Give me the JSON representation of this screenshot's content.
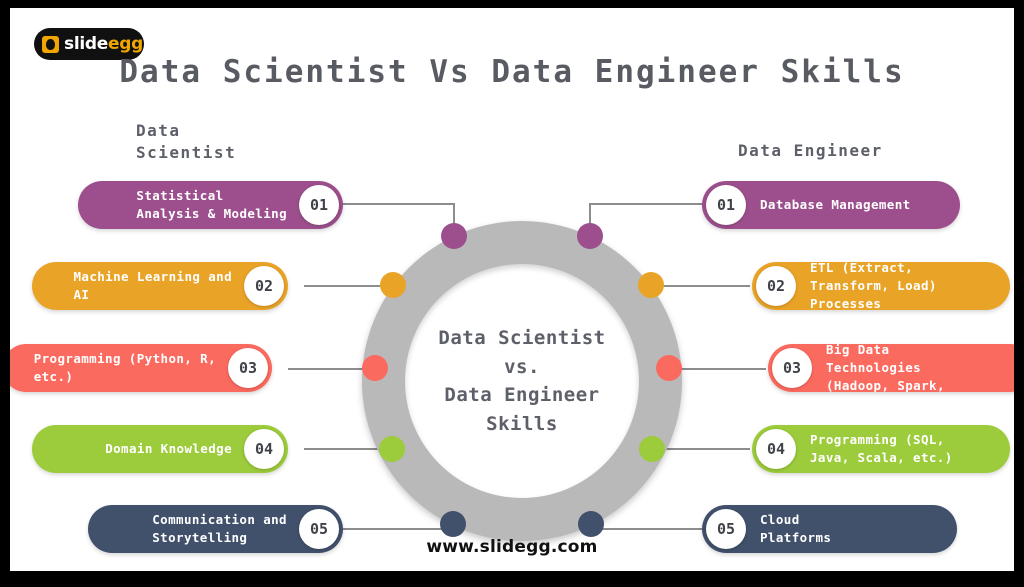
{
  "brand": {
    "logo_text_part1": "slide",
    "logo_text_part2": "egg",
    "logo_icon": "egg-icon"
  },
  "title": "Data Scientist Vs Data Engineer Skills",
  "columns": {
    "left_heading": "Data\nScientist",
    "right_heading": "Data Engineer"
  },
  "center": {
    "text": "Data Scientist\nvs.\nData Engineer\nSkills"
  },
  "colors": {
    "purple": "#9c4f8c",
    "orange": "#e9a327",
    "coral": "#fb6a5f",
    "green": "#9ccb3b",
    "slate": "#41506b",
    "ring": "#b9b9b9",
    "connector": "#8d8d8d",
    "text_gray": "#5d6068"
  },
  "left_items": [
    {
      "number": "01",
      "label": "Statistical\nAnalysis & Modeling",
      "color": "#9c4f8c"
    },
    {
      "number": "02",
      "label": "Machine Learning and\nAI",
      "color": "#e9a327"
    },
    {
      "number": "03",
      "label": "Programming (Python, R,\netc.)",
      "color": "#fb6a5f"
    },
    {
      "number": "04",
      "label": "Domain Knowledge",
      "color": "#9ccb3b"
    },
    {
      "number": "05",
      "label": "Communication and\nStorytelling",
      "color": "#41506b"
    }
  ],
  "right_items": [
    {
      "number": "01",
      "label": "Database Management",
      "color": "#9c4f8c"
    },
    {
      "number": "02",
      "label": "ETL (Extract,\nTransform, Load)\nProcesses",
      "color": "#e9a327"
    },
    {
      "number": "03",
      "label": "Big Data\nTechnologies\n(Hadoop, Spark,",
      "color": "#fb6a5f"
    },
    {
      "number": "04",
      "label": "Programming (SQL,\nJava, Scala, etc.)",
      "color": "#9ccb3b"
    },
    {
      "number": "05",
      "label": "Cloud\nPlatforms",
      "color": "#41506b"
    }
  ],
  "footer": "www.slidegg.com"
}
